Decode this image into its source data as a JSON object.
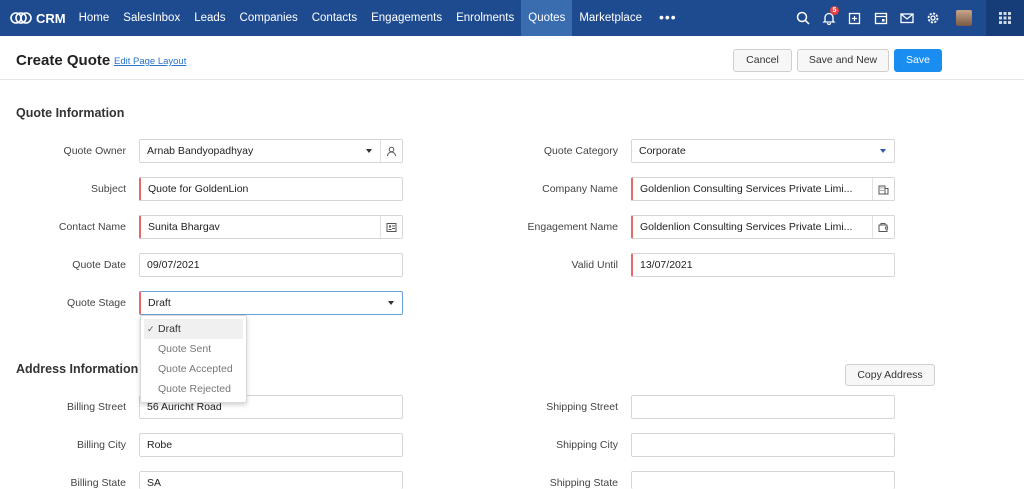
{
  "nav": {
    "logo_text": "CRM",
    "links": [
      "Home",
      "SalesInbox",
      "Leads",
      "Companies",
      "Contacts",
      "Engagements",
      "Enrolments",
      "Quotes",
      "Marketplace"
    ],
    "more": "•••",
    "notification_count": "5",
    "accent": "#1e4b8f"
  },
  "header": {
    "title": "Create Quote",
    "edit_layout": "Edit Page Layout",
    "cancel": "Cancel",
    "save_new": "Save and New",
    "save": "Save"
  },
  "quote_info": {
    "title": "Quote Information",
    "quote_owner": {
      "label": "Quote Owner",
      "value": "Arnab Bandyopadhyay"
    },
    "subject": {
      "label": "Subject",
      "value": "Quote for GoldenLion"
    },
    "contact_name": {
      "label": "Contact Name",
      "value": "Sunita Bhargav"
    },
    "quote_date": {
      "label": "Quote Date",
      "value": "09/07/2021"
    },
    "quote_stage": {
      "label": "Quote Stage",
      "value": "Draft"
    },
    "quote_category": {
      "label": "Quote Category",
      "value": "Corporate"
    },
    "company_name": {
      "label": "Company Name",
      "value": "Goldenlion Consulting Services Private Limi..."
    },
    "engagement_name": {
      "label": "Engagement Name",
      "value": "Goldenlion Consulting Services Private Limi..."
    },
    "valid_until": {
      "label": "Valid Until",
      "value": "13/07/2021"
    }
  },
  "stage_dropdown": {
    "options": [
      "Draft",
      "Quote Sent",
      "Quote Accepted",
      "Quote Rejected"
    ],
    "selected": "Draft"
  },
  "address_info": {
    "title": "Address Information",
    "copy_address": "Copy Address",
    "billing_street": {
      "label": "Billing Street",
      "value": "56 Auricht Road"
    },
    "billing_city": {
      "label": "Billing City",
      "value": "Robe"
    },
    "billing_state": {
      "label": "Billing State",
      "value": "SA"
    },
    "shipping_street": {
      "label": "Shipping Street",
      "value": ""
    },
    "shipping_city": {
      "label": "Shipping City",
      "value": ""
    },
    "shipping_state": {
      "label": "Shipping State",
      "value": ""
    }
  }
}
